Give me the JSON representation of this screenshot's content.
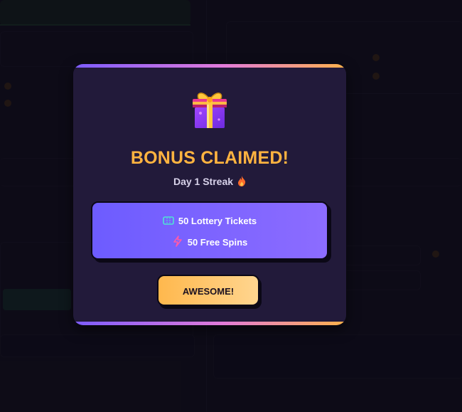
{
  "modal": {
    "title": "BONUS CLAIMED!",
    "subtitle": "Day 1 Streak",
    "subtitle_icon": "fire-icon",
    "gift_icon": "gift-icon",
    "rewards": [
      {
        "icon": "ticket-icon",
        "label": "50 Lottery Tickets"
      },
      {
        "icon": "lightning-icon",
        "label": "50 Free Spins"
      }
    ],
    "button_label": "AWESOME!"
  },
  "colors": {
    "title": "#ffb340",
    "modal_bg": "#221a3a",
    "rewards_bg": "#7c64ff",
    "button_bg": "#ffc46a",
    "stripe_start": "#7c5cff",
    "stripe_end": "#ffb24a"
  }
}
